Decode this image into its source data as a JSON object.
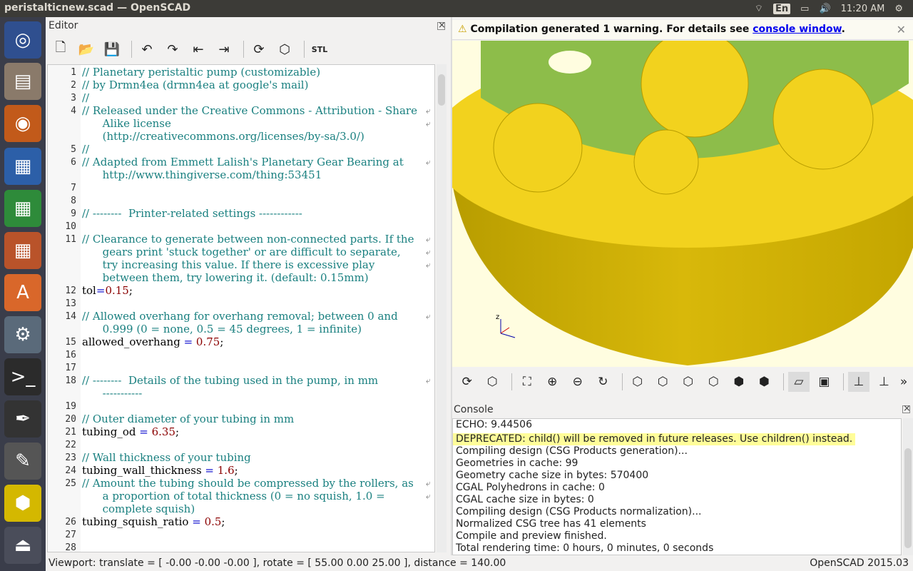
{
  "topbar": {
    "window_title": "peristalticnew.scad — OpenSCAD",
    "lang": "En",
    "time": "11:20 AM"
  },
  "launcher": {
    "items": [
      "ubuntu-dash",
      "files",
      "firefox",
      "writer",
      "calc",
      "impress",
      "software-center",
      "system-settings",
      "terminal",
      "inkscape",
      "gimp",
      "openscad",
      "usb"
    ]
  },
  "editor": {
    "title": "Editor",
    "toolbar": [
      "new",
      "open",
      "save",
      "undo",
      "redo",
      "unindent",
      "indent",
      "preview",
      "render",
      "STL"
    ],
    "stl_label": "STL",
    "lines": [
      {
        "n": "1",
        "t": "// Planetary peristaltic pump (customizable)",
        "k": "cm"
      },
      {
        "n": "2",
        "t": "// by Drmn4ea (drmn4ea at google's mail)",
        "k": "cm"
      },
      {
        "n": "3",
        "t": "//",
        "k": "cm"
      },
      {
        "n": "4",
        "t": "// Released under the Creative Commons - Attribution - Share",
        "k": "cm",
        "w": true
      },
      {
        "n": "",
        "t": "      Alike license",
        "k": "cm",
        "w": true
      },
      {
        "n": "",
        "t": "      (http://creativecommons.org/licenses/by-sa/3.0/)",
        "k": "cm"
      },
      {
        "n": "5",
        "t": "//",
        "k": "cm"
      },
      {
        "n": "6",
        "t": "// Adapted from Emmett Lalish's Planetary Gear Bearing at",
        "k": "cm",
        "w": true
      },
      {
        "n": "",
        "t": "      http://www.thingiverse.com/thing:53451",
        "k": "cm"
      },
      {
        "n": "7",
        "t": "",
        "k": ""
      },
      {
        "n": "8",
        "t": "",
        "k": ""
      },
      {
        "n": "9",
        "t": "// --------  Printer-related settings ------------",
        "k": "cm"
      },
      {
        "n": "10",
        "t": "",
        "k": ""
      },
      {
        "n": "11",
        "t": "// Clearance to generate between non-connected parts. If the",
        "k": "cm",
        "w": true
      },
      {
        "n": "",
        "t": "      gears print 'stuck together' or are difficult to separate,",
        "k": "cm",
        "w": true
      },
      {
        "n": "",
        "t": "      try increasing this value. If there is excessive play",
        "k": "cm",
        "w": true
      },
      {
        "n": "",
        "t": "      between them, try lowering it. (default: 0.15mm)",
        "k": "cm"
      },
      {
        "n": "12",
        "t": "tol=0.15;",
        "k": "code",
        "var": "tol",
        "eq": "=",
        "val": "0.15"
      },
      {
        "n": "13",
        "t": "",
        "k": ""
      },
      {
        "n": "14",
        "t": "// Allowed overhang for overhang removal; between 0 and",
        "k": "cm",
        "w": true
      },
      {
        "n": "",
        "t": "      0.999 (0 = none, 0.5 = 45 degrees, 1 = infinite)",
        "k": "cm"
      },
      {
        "n": "15",
        "t": "allowed_overhang = 0.75;",
        "k": "code",
        "var": "allowed_overhang ",
        "eq": "=",
        "val": " 0.75"
      },
      {
        "n": "16",
        "t": "",
        "k": ""
      },
      {
        "n": "17",
        "t": "",
        "k": ""
      },
      {
        "n": "18",
        "t": "// --------  Details of the tubing used in the pump, in mm",
        "k": "cm",
        "w": true
      },
      {
        "n": "",
        "t": "      -----------",
        "k": "cm"
      },
      {
        "n": "19",
        "t": "",
        "k": ""
      },
      {
        "n": "20",
        "t": "// Outer diameter of your tubing in mm",
        "k": "cm"
      },
      {
        "n": "21",
        "t": "tubing_od = 6.35;",
        "k": "code",
        "var": "tubing_od ",
        "eq": "=",
        "val": " 6.35"
      },
      {
        "n": "22",
        "t": "",
        "k": ""
      },
      {
        "n": "23",
        "t": "// Wall thickness of your tubing",
        "k": "cm"
      },
      {
        "n": "24",
        "t": "tubing_wall_thickness = 1.6;",
        "k": "code",
        "var": "tubing_wall_thickness ",
        "eq": "=",
        "val": " 1.6"
      },
      {
        "n": "25",
        "t": "// Amount the tubing should be compressed by the rollers, as",
        "k": "cm",
        "w": true
      },
      {
        "n": "",
        "t": "      a proportion of total thickness (0 = no squish, 1.0 =",
        "k": "cm",
        "w": true
      },
      {
        "n": "",
        "t": "      complete squish)",
        "k": "cm"
      },
      {
        "n": "26",
        "t": "tubing_squish_ratio = 0.5;",
        "k": "code",
        "var": "tubing_squish_ratio ",
        "eq": "=",
        "val": " 0.5"
      },
      {
        "n": "27",
        "t": "",
        "k": ""
      },
      {
        "n": "28",
        "t": "",
        "k": ""
      }
    ]
  },
  "warning": {
    "prefix": "Compilation generated 1 warning. For details see ",
    "link": "console window",
    "suffix": "."
  },
  "view_toolbar": [
    "preview",
    "render",
    "view-all",
    "zoom-in",
    "zoom-out",
    "reset-view",
    "right",
    "top",
    "bottom",
    "left",
    "front",
    "back",
    "perspective",
    "orthogonal",
    "axes",
    "scale-markers"
  ],
  "console": {
    "title": "Console",
    "lines": [
      {
        "t": "ECHO: 9.44506",
        "dep": false
      },
      {
        "t": "DEPRECATED: child() will be removed in future releases. Use children() instead.",
        "dep": true
      },
      {
        "t": "Compiling design (CSG Products generation)...",
        "dep": false
      },
      {
        "t": "Geometries in cache: 99",
        "dep": false
      },
      {
        "t": "Geometry cache size in bytes: 570400",
        "dep": false
      },
      {
        "t": "CGAL Polyhedrons in cache: 0",
        "dep": false
      },
      {
        "t": "CGAL cache size in bytes: 0",
        "dep": false
      },
      {
        "t": "Compiling design (CSG Products normalization)...",
        "dep": false
      },
      {
        "t": "Normalized CSG tree has 41 elements",
        "dep": false
      },
      {
        "t": "Compile and preview finished.",
        "dep": false
      },
      {
        "t": "Total rendering time: 0 hours, 0 minutes, 0 seconds",
        "dep": false
      }
    ]
  },
  "status": {
    "viewport": "Viewport: translate = [ -0.00 -0.00 -0.00 ], rotate = [ 55.00 0.00 25.00 ], distance = 140.00",
    "version": "OpenSCAD 2015.03"
  },
  "axes_label": "z",
  "colors": {
    "accent": "#e0c000",
    "body": "#f2d21e",
    "green": "#8dbd4a",
    "viewport_bg": "#fffde0"
  }
}
